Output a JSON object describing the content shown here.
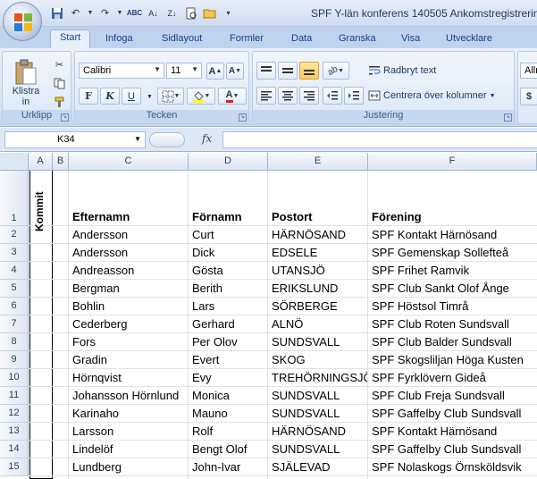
{
  "window": {
    "title": "SPF Y-län konferens 140505 Ankomstregistrering"
  },
  "quick_access": [
    "save-icon",
    "undo-icon",
    "redo-icon",
    "spellcheck-icon",
    "sort-asc-icon",
    "sort-desc-icon",
    "print-preview-icon",
    "open-icon",
    "customize-icon"
  ],
  "tabs": [
    {
      "label": "Start",
      "active": true
    },
    {
      "label": "Infoga"
    },
    {
      "label": "Sidlayout"
    },
    {
      "label": "Formler"
    },
    {
      "label": "Data"
    },
    {
      "label": "Granska"
    },
    {
      "label": "Visa"
    },
    {
      "label": "Utvecklare"
    }
  ],
  "ribbon": {
    "clipboard": {
      "label": "Urklipp",
      "paste": "Klistra",
      "paste_sub": "in"
    },
    "font": {
      "label": "Tecken",
      "name": "Calibri",
      "size": "11",
      "grow": "A",
      "shrink": "A",
      "bold": "F",
      "italic": "K",
      "underline": "U",
      "color_letter": "A"
    },
    "alignment": {
      "label": "Justering",
      "wrap": "Radbryt text",
      "merge": "Centrera över kolumner"
    },
    "number": {
      "format": "Allm",
      "currency": "$"
    }
  },
  "formula_bar": {
    "cell_ref": "K34",
    "fx": "fx",
    "value": ""
  },
  "columns": [
    "A",
    "B",
    "C",
    "D",
    "E",
    "F"
  ],
  "header_row": {
    "kommit": "Kommit",
    "efternamn": "Efternamn",
    "fornamn": "Förnamn",
    "postort": "Postort",
    "forening": "Förening"
  },
  "rows": [
    {
      "n": "2",
      "efternamn": "Andersson",
      "fornamn": "Curt",
      "postort": "HÄRNÖSAND",
      "forening": "SPF Kontakt Härnösand"
    },
    {
      "n": "3",
      "efternamn": "Andersson",
      "fornamn": "Dick",
      "postort": "EDSELE",
      "forening": "SPF Gemenskap Sollefteå"
    },
    {
      "n": "4",
      "efternamn": "Andreasson",
      "fornamn": "Gösta",
      "postort": "UTANSJÖ",
      "forening": "SPF Frihet Ramvik"
    },
    {
      "n": "5",
      "efternamn": "Bergman",
      "fornamn": "Berith",
      "postort": "ERIKSLUND",
      "forening": "SPF Club Sankt Olof Ånge"
    },
    {
      "n": "6",
      "efternamn": "Bohlin",
      "fornamn": "Lars",
      "postort": "SÖRBERGE",
      "forening": "SPF Höstsol Timrå"
    },
    {
      "n": "7",
      "efternamn": "Cederberg",
      "fornamn": "Gerhard",
      "postort": "ALNÖ",
      "forening": "SPF Club Roten Sundsvall"
    },
    {
      "n": "8",
      "efternamn": "Fors",
      "fornamn": "Per Olov",
      "postort": "SUNDSVALL",
      "forening": "SPF Club Balder Sundsvall"
    },
    {
      "n": "9",
      "efternamn": "Gradin",
      "fornamn": "Evert",
      "postort": "SKOG",
      "forening": "SPF Skogsliljan Höga Kusten"
    },
    {
      "n": "10",
      "efternamn": "Hörnqvist",
      "fornamn": "Evy",
      "postort": "TREHÖRNINGSJÖ",
      "forening": "SPF Fyrklövern Gideå"
    },
    {
      "n": "11",
      "efternamn": "Johansson Hörnlund",
      "fornamn": "Monica",
      "postort": "SUNDSVALL",
      "forening": "SPF Club Freja Sundsvall"
    },
    {
      "n": "12",
      "efternamn": "Karinaho",
      "fornamn": "Mauno",
      "postort": "SUNDSVALL",
      "forening": "SPF Gaffelby Club Sundsvall"
    },
    {
      "n": "13",
      "efternamn": "Larsson",
      "fornamn": "Rolf",
      "postort": "HÄRNÖSAND",
      "forening": "SPF Kontakt Härnösand"
    },
    {
      "n": "14",
      "efternamn": "Lindelöf",
      "fornamn": "Bengt Olof",
      "postort": "SUNDSVALL",
      "forening": "SPF Gaffelby Club Sundsvall"
    },
    {
      "n": "15",
      "efternamn": "Lundberg",
      "fornamn": "John-Ivar",
      "postort": "SJÄLEVAD",
      "forening": "SPF Nolaskogs Örnsköldsvik"
    }
  ]
}
